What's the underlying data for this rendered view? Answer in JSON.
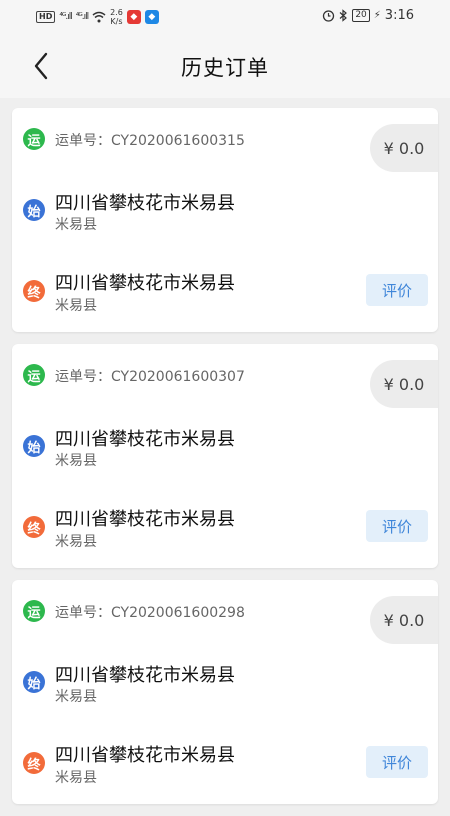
{
  "status_bar": {
    "hd_label": "HD",
    "signal1": "⁴ᴳ.ıll",
    "signal2": "⁴ᴳ.ıll",
    "speed": "2.6\nK/s",
    "battery": "20",
    "time": "3:16",
    "icons": [
      "hd-icon",
      "signal-icon",
      "signal-icon",
      "wifi-icon",
      "app-icon",
      "app-icon",
      "alarm-icon",
      "bluetooth-icon",
      "battery-icon",
      "charging-icon"
    ]
  },
  "header": {
    "title": "历史订单",
    "back_icon": "chevron-left-icon"
  },
  "orders": [
    {
      "waybill_label": "运单号：",
      "waybill_no": "CY2020061600315",
      "price": "¥ 0.0",
      "badge_waybill": "运",
      "badge_start": "始",
      "badge_end": "终",
      "start_address": "四川省攀枝花市米易县",
      "start_sub": "米易县",
      "end_address": "四川省攀枝花市米易县",
      "end_sub": "米易县",
      "rate_label": "评价"
    },
    {
      "waybill_label": "运单号：",
      "waybill_no": "CY2020061600307",
      "price": "¥ 0.0",
      "badge_waybill": "运",
      "badge_start": "始",
      "badge_end": "终",
      "start_address": "四川省攀枝花市米易县",
      "start_sub": "米易县",
      "end_address": "四川省攀枝花市米易县",
      "end_sub": "米易县",
      "rate_label": "评价"
    },
    {
      "waybill_label": "运单号：",
      "waybill_no": "CY2020061600298",
      "price": "¥ 0.0",
      "badge_waybill": "运",
      "badge_start": "始",
      "badge_end": "终",
      "start_address": "四川省攀枝花市米易县",
      "start_sub": "米易县",
      "end_address": "四川省攀枝花市米易县",
      "end_sub": "米易县",
      "rate_label": "评价"
    }
  ],
  "colors": {
    "waybill_badge": "#2db84d",
    "start_badge": "#3a73d6",
    "end_badge": "#f26b3a",
    "rate_button_bg": "#e3effa",
    "rate_button_text": "#3f86d9"
  }
}
